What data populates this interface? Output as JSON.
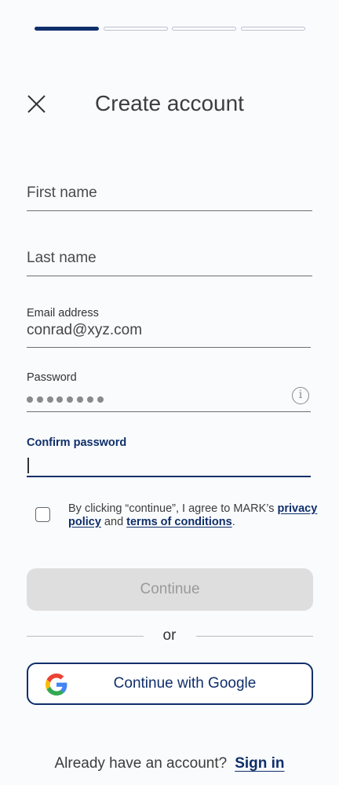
{
  "progress": {
    "total_steps": 4,
    "current_step": 1
  },
  "header": {
    "title": "Create account"
  },
  "form": {
    "first_name": {
      "placeholder": "First name"
    },
    "last_name": {
      "placeholder": "Last name"
    },
    "email": {
      "label": "Email address",
      "value": "conrad@xyz.com"
    },
    "password": {
      "label": "Password",
      "masked_length": 8
    },
    "confirm_password": {
      "label": "Confirm password",
      "value": ""
    }
  },
  "agreement": {
    "prefix": "By clicking “continue”, I agree to MARK’s ",
    "privacy_link": "privacy policy",
    "middle": " and ",
    "terms_link": "terms of conditions",
    "suffix": "."
  },
  "actions": {
    "continue_label": "Continue",
    "divider_text": "or",
    "google_label": "Continue with Google"
  },
  "footer": {
    "prompt": "Already have an account?",
    "signin_label": "Sign in"
  },
  "colors": {
    "brand": "#0f2f6b",
    "background": "#fafbfd",
    "disabled_button": "#dedede"
  }
}
